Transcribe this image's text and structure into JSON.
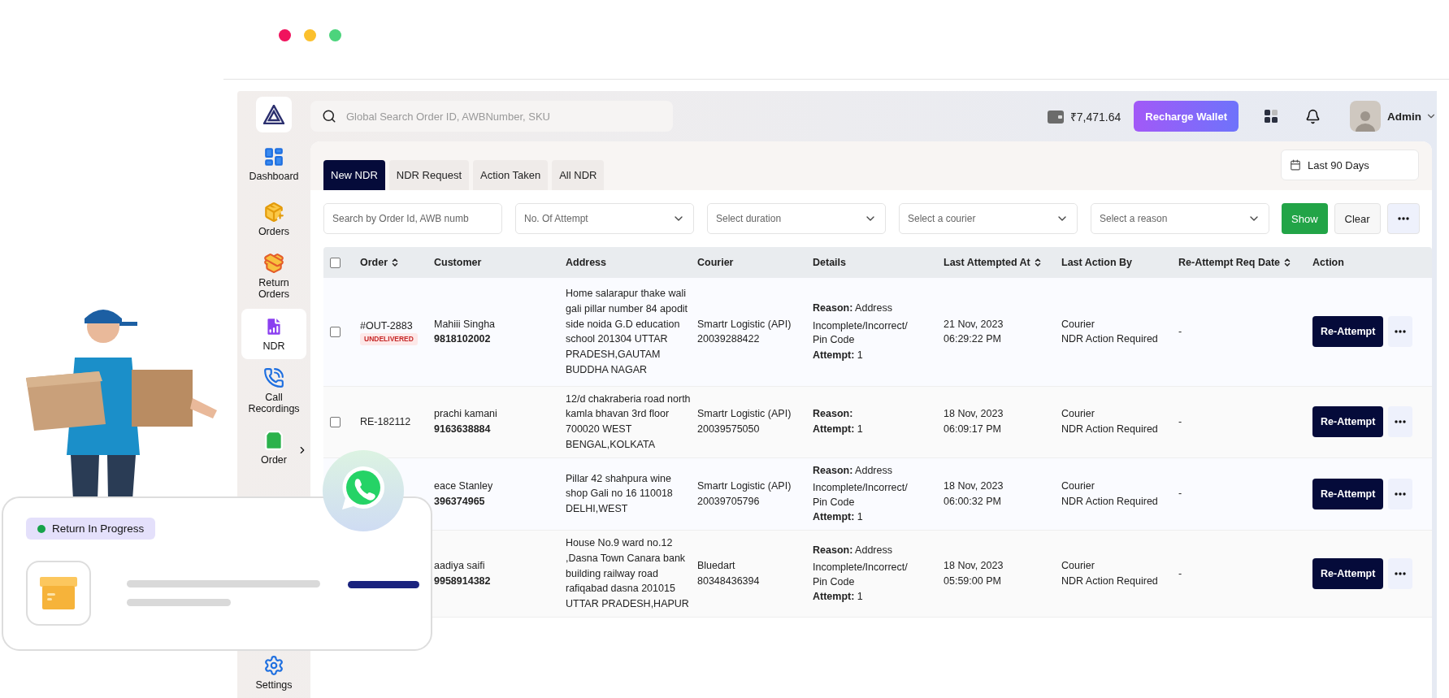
{
  "top_search": {
    "placeholder": "Global Search Order ID, AWBNumber, SKU"
  },
  "wallet": {
    "balance": "₹7,471.64",
    "button": "Recharge Wallet"
  },
  "user": {
    "name": "Admin"
  },
  "sidebar": {
    "items": [
      {
        "label": "Dashboard",
        "selected": false,
        "submenu": false
      },
      {
        "label": "Orders",
        "selected": false,
        "submenu": false
      },
      {
        "label": "Return Orders",
        "selected": false,
        "submenu": false
      },
      {
        "label": "NDR",
        "selected": true,
        "submenu": false
      },
      {
        "label": "Call Recordings",
        "selected": false,
        "submenu": false
      },
      {
        "label": "Order",
        "selected": false,
        "submenu": true
      },
      {
        "label": "Settings",
        "selected": false,
        "submenu": false
      }
    ]
  },
  "tabs": [
    {
      "label": "New NDR",
      "selected": true
    },
    {
      "label": "NDR Request",
      "selected": false
    },
    {
      "label": "Action Taken",
      "selected": false
    },
    {
      "label": "All NDR",
      "selected": false
    }
  ],
  "date_range": "Last 90 Days",
  "filters": {
    "search_placeholder": "Search by Order Id, AWB numb",
    "selects": [
      "No. Of Attempt",
      "Select duration",
      "Select a courier",
      "Select a reason"
    ],
    "show": "Show",
    "clear": "Clear"
  },
  "table": {
    "select_all_checked": false,
    "columns": [
      {
        "label": "Order",
        "sortable": true
      },
      {
        "label": "Customer",
        "sortable": false
      },
      {
        "label": "Address",
        "sortable": false
      },
      {
        "label": "Courier",
        "sortable": false
      },
      {
        "label": "Details",
        "sortable": false
      },
      {
        "label": "Last Attempted At",
        "sortable": true
      },
      {
        "label": "Last Action By",
        "sortable": false
      },
      {
        "label": "Re-Attempt Req Date",
        "sortable": true
      },
      {
        "label": "Action",
        "sortable": false
      }
    ],
    "rows": [
      {
        "checked": false,
        "order": "#OUT-2883",
        "status": "UNDELIVERED",
        "customer": "Mahiii Singha",
        "phone": "9818102002",
        "address": "Home salarapur thake wali gali pillar number 84 apodit side noida G.D education school 201304 UTTAR PRADESH,GAUTAM BUDDHA NAGAR",
        "courier": "Smartr Logistic (API)",
        "awb": "20039288422",
        "reason": "**Reason:** Address",
        "reason_more": "Incomplete/Incorrect/ Pin Code",
        "attempt": "**Attempt:** 1",
        "date": "21 Nov, 2023",
        "time": "06:29:22 PM",
        "action_by": "Courier",
        "action_note": "NDR Action Required",
        "req_date": "-",
        "button": "Re-Attempt"
      },
      {
        "checked": false,
        "order": "RE-182112",
        "customer": "prachi kamani",
        "phone": "9163638884",
        "address": "12/d chakraberia road north kamla bhavan 3rd floor 700020 WEST BENGAL,KOLKATA",
        "courier": "Smartr Logistic (API)",
        "awb": "20039575050",
        "reason": "**Reason:**",
        "attempt": "**Attempt:** 1",
        "date": "18 Nov, 2023",
        "time": "06:09:17 PM",
        "action_by": "Courier",
        "action_note": "NDR Action Required",
        "req_date": "-",
        "button": "Re-Attempt"
      },
      {
        "customer": "eace Stanley",
        "phone": "396374965",
        "address": "Pillar 42 shahpura wine shop Gali no 16 110018 DELHI,WEST",
        "courier": "Smartr Logistic (API)",
        "awb": "20039705796",
        "reason": "**Reason:** Address",
        "reason_more": "Incomplete/Incorrect/ Pin Code",
        "attempt": "**Attempt:** 1",
        "date": "18 Nov, 2023",
        "time": "06:00:32 PM",
        "action_by": "Courier",
        "action_note": "NDR Action Required",
        "req_date": "-",
        "button": "Re-Attempt"
      },
      {
        "customer": "aadiya saifi",
        "phone": "9958914382",
        "address": "House No.9 ward no.12 ,Dasna Town Canara bank building railway road rafiqabad dasna 201015 UTTAR PRADESH,HAPUR",
        "courier": "Bluedart",
        "awb": "80348436394",
        "reason": "**Reason:** Address",
        "reason_more": "Incomplete/Incorrect/ Pin Code",
        "attempt": "**Attempt:** 1",
        "date": "18 Nov, 2023",
        "time": "05:59:00 PM",
        "action_by": "Courier",
        "action_note": "NDR Action Required",
        "req_date": "-",
        "button": "Re-Attempt"
      }
    ]
  },
  "promo_card": {
    "status": {
      "label": "Return In Progress",
      "color": "#16a34a"
    }
  }
}
